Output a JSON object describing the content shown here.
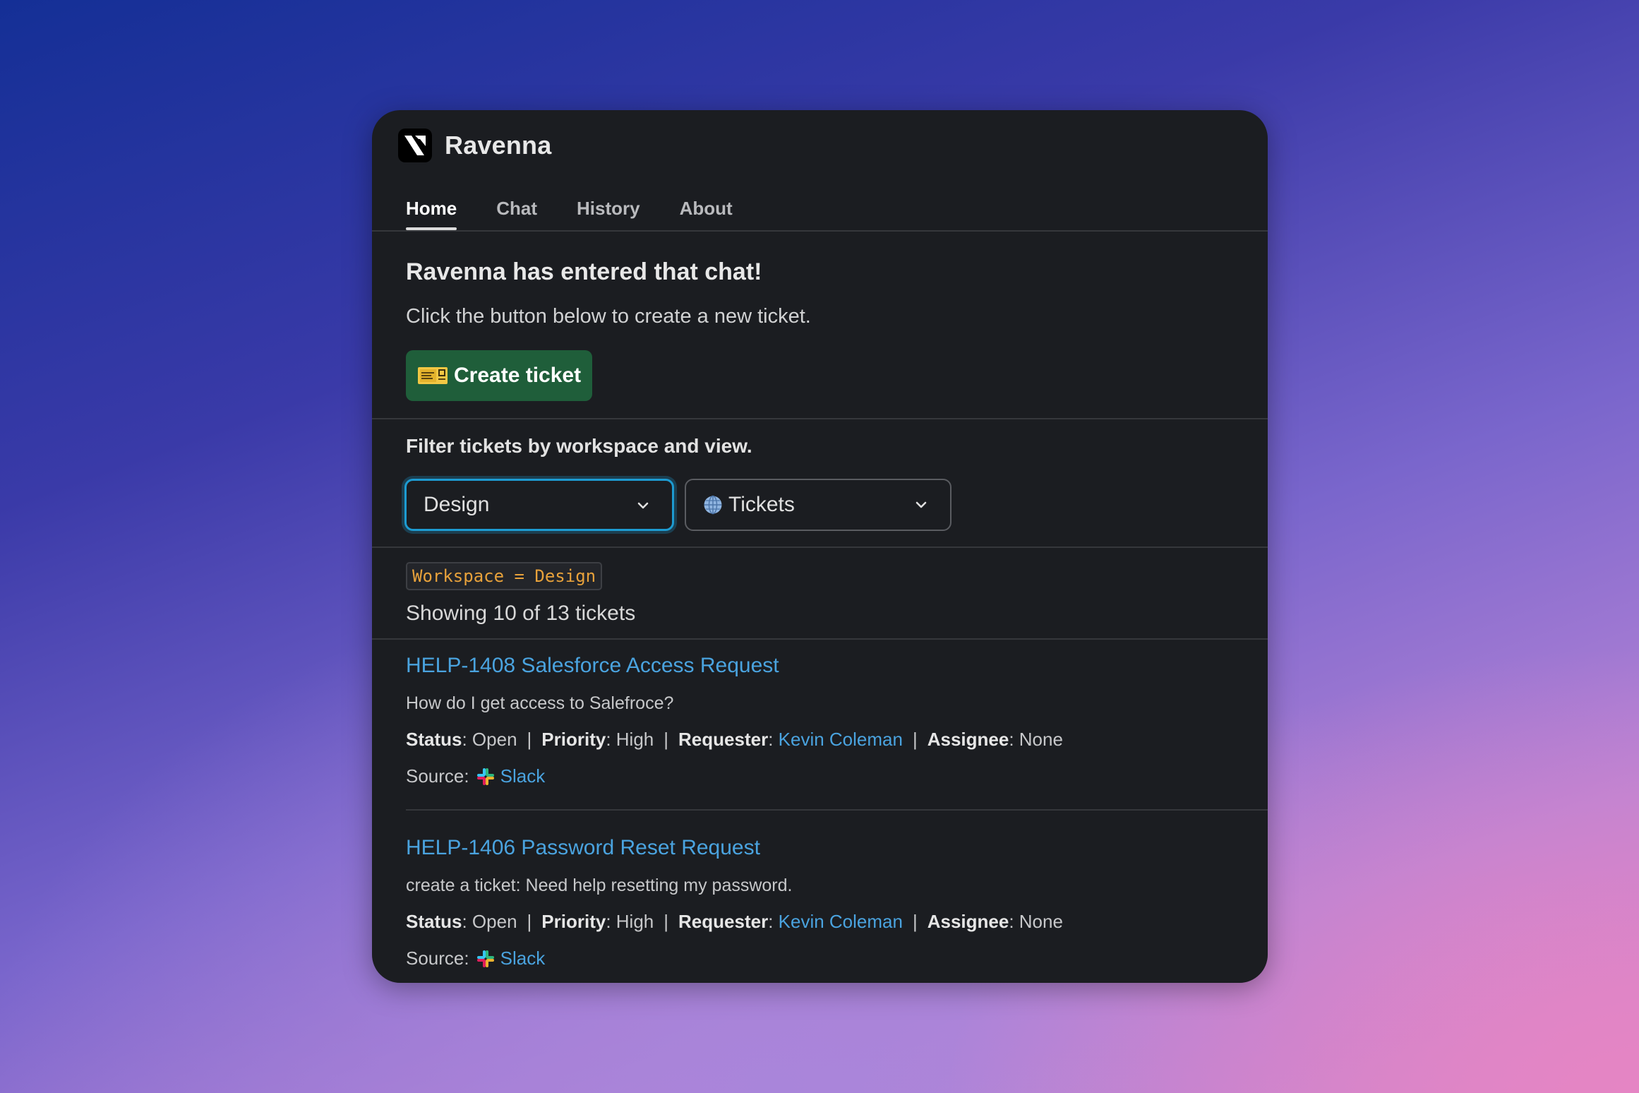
{
  "app": {
    "name": "Ravenna"
  },
  "tabs": [
    {
      "label": "Home",
      "active": true
    },
    {
      "label": "Chat",
      "active": false
    },
    {
      "label": "History",
      "active": false
    },
    {
      "label": "About",
      "active": false
    }
  ],
  "welcome": {
    "heading": "Ravenna has entered that chat!",
    "subtext": "Click the button below to create a new ticket.",
    "create_button": "Create ticket",
    "create_icon": "admission-ticket-icon"
  },
  "filter": {
    "label": "Filter tickets by workspace and view.",
    "workspace_select": {
      "value": "Design"
    },
    "view_select": {
      "value": "Tickets",
      "icon": "globe-icon"
    }
  },
  "results": {
    "query": "Workspace = Design",
    "summary": "Showing 10 of 13 tickets"
  },
  "labels": {
    "status": "Status",
    "priority": "Priority",
    "requester": "Requester",
    "assignee": "Assignee",
    "source": "Source:"
  },
  "tickets": [
    {
      "title": "HELP-1408 Salesforce Access Request",
      "description": "How do I get access to Salefroce?",
      "status": "Open",
      "priority": "High",
      "requester": "Kevin Coleman",
      "assignee": "None",
      "source": "Slack"
    },
    {
      "title": "HELP-1406 Password Reset Request",
      "description": "create a ticket: Need help resetting my password.",
      "status": "Open",
      "priority": "High",
      "requester": "Kevin Coleman",
      "assignee": "None",
      "source": "Slack"
    }
  ],
  "colors": {
    "panel_bg": "#1b1d21",
    "link": "#4aa3df",
    "button_green": "#1f5e3a",
    "focus_blue": "#1d9bd1",
    "code_orange": "#e8a23b"
  }
}
